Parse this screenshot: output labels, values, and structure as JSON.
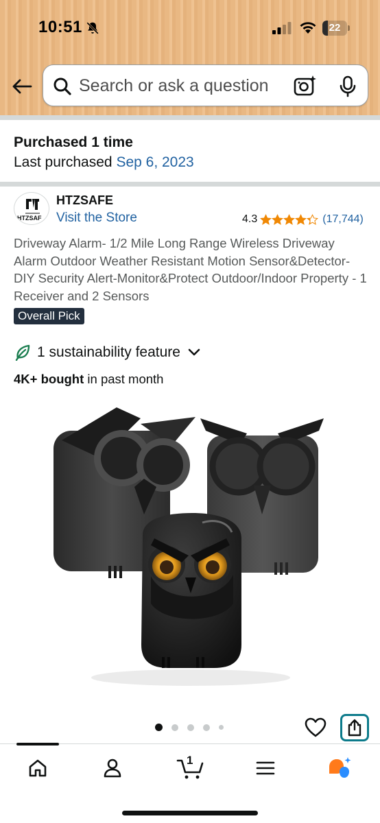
{
  "status_bar": {
    "time": "10:51",
    "battery_level": "22",
    "battery_fraction": 0.22
  },
  "search": {
    "placeholder": "Search or ask a question"
  },
  "purchase": {
    "title": "Purchased 1 time",
    "last_label": "Last purchased",
    "last_date": "Sep 6, 2023"
  },
  "product": {
    "brand": "HTZSAFE",
    "logo_text": "HTZSAF",
    "visit_store": "Visit the Store",
    "rating": "4.3",
    "rating_value": 4.3,
    "rating_count": "(17,744)",
    "title": "Driveway Alarm- 1/2 Mile Long Range Wireless Driveway Alarm Outdoor Weather Resistant Motion Sensor&Detector-DIY Security Alert-Monitor&Protect Outdoor/Indoor Property - 1 Receiver and 2 Sensors",
    "badge": "Overall Pick",
    "sustainability": "1 sustainability feature",
    "bought_bold": "4K+ bought",
    "bought_rest": " in past month"
  },
  "gallery": {
    "image_count": 5,
    "active_index": 0
  },
  "bottom_nav": {
    "cart_count": "1"
  },
  "colors": {
    "header": "#e9b883",
    "link": "#2162a1",
    "star": "#f08804",
    "badge": "#232f3e",
    "share_border": "#0b7a8a",
    "leaf": "#1a7d4f",
    "rufus_orange": "#ff7a1a",
    "rufus_blue": "#2a8dff"
  },
  "icons": [
    "back-arrow-icon",
    "search-icon",
    "camera-icon",
    "mic-icon",
    "leaf-icon",
    "chevron-down-icon",
    "heart-icon",
    "share-icon",
    "home-icon",
    "person-icon",
    "cart-icon",
    "menu-icon",
    "rufus-icon"
  ]
}
